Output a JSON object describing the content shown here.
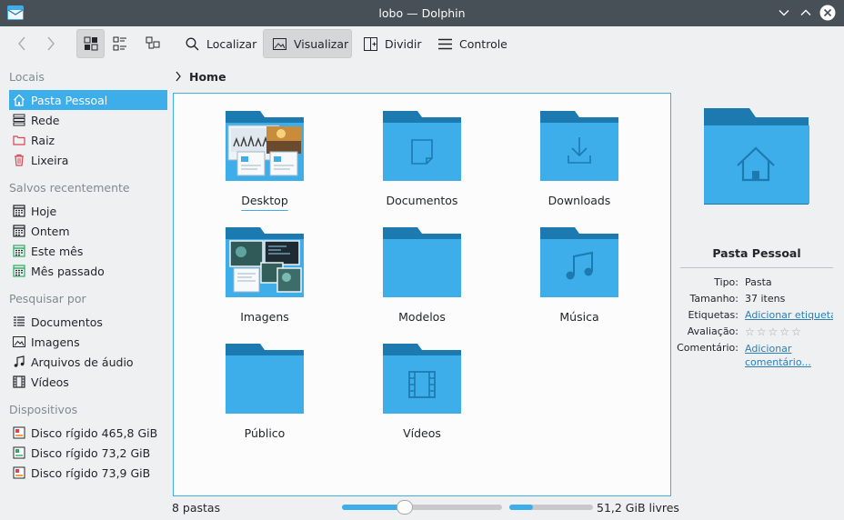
{
  "window": {
    "title": "lobo — Dolphin"
  },
  "toolbar": {
    "search_label": "Localizar",
    "preview_label": "Visualizar",
    "split_label": "Dividir",
    "control_label": "Controle"
  },
  "sidebar": {
    "sections": [
      {
        "title": "Locais",
        "items": [
          {
            "label": "Pasta Pessoal",
            "icon": "home-icon",
            "selected": true
          },
          {
            "label": "Rede",
            "icon": "network-icon"
          },
          {
            "label": "Raiz",
            "icon": "root-folder-icon"
          },
          {
            "label": "Lixeira",
            "icon": "trash-icon"
          }
        ]
      },
      {
        "title": "Salvos recentemente",
        "items": [
          {
            "label": "Hoje",
            "icon": "calendar-icon"
          },
          {
            "label": "Ontem",
            "icon": "calendar-icon"
          },
          {
            "label": "Este mês",
            "icon": "calendar-icon"
          },
          {
            "label": "Mês passado",
            "icon": "calendar-icon"
          }
        ]
      },
      {
        "title": "Pesquisar por",
        "items": [
          {
            "label": "Documentos",
            "icon": "document-list-icon"
          },
          {
            "label": "Imagens",
            "icon": "image-icon"
          },
          {
            "label": "Arquivos de áudio",
            "icon": "music-note-icon"
          },
          {
            "label": "Vídeos",
            "icon": "film-icon"
          }
        ]
      },
      {
        "title": "Dispositivos",
        "items": [
          {
            "label": "Disco rígido 465,8 GiB",
            "icon": "hard-drive-icon"
          },
          {
            "label": "Disco rígido 73,2 GiB",
            "icon": "hard-drive-icon"
          },
          {
            "label": "Disco rígido 73,9 GiB",
            "icon": "hard-drive-icon"
          }
        ]
      }
    ]
  },
  "breadcrumb": {
    "current": "Home"
  },
  "files": [
    {
      "name": "Desktop",
      "kind": "desktop"
    },
    {
      "name": "Documentos",
      "kind": "documents"
    },
    {
      "name": "Downloads",
      "kind": "downloads"
    },
    {
      "name": "Imagens",
      "kind": "images"
    },
    {
      "name": "Modelos",
      "kind": "templates"
    },
    {
      "name": "Música",
      "kind": "music"
    },
    {
      "name": "Público",
      "kind": "public"
    },
    {
      "name": "Vídeos",
      "kind": "videos"
    }
  ],
  "info_panel": {
    "name": "Pasta Pessoal",
    "type_label": "Tipo:",
    "type_value": "Pasta",
    "size_label": "Tamanho:",
    "size_value": "37 itens",
    "tags_label": "Etiquetas:",
    "tags_value": "Adicionar etiquetas",
    "rating_label": "Avaliação:",
    "rating_value": 0,
    "rating_max": 5,
    "comment_label": "Comentário:",
    "comment_value": "Adicionar comentário..."
  },
  "status": {
    "count": "8 pastas",
    "zoom_fraction": 0.39,
    "free_space": "51,2 GiB livres",
    "used_fraction": 0.28
  },
  "colors": {
    "accent": "#3daee9",
    "folder": "#3daee9",
    "folder_tab": "#1d7ab0"
  }
}
